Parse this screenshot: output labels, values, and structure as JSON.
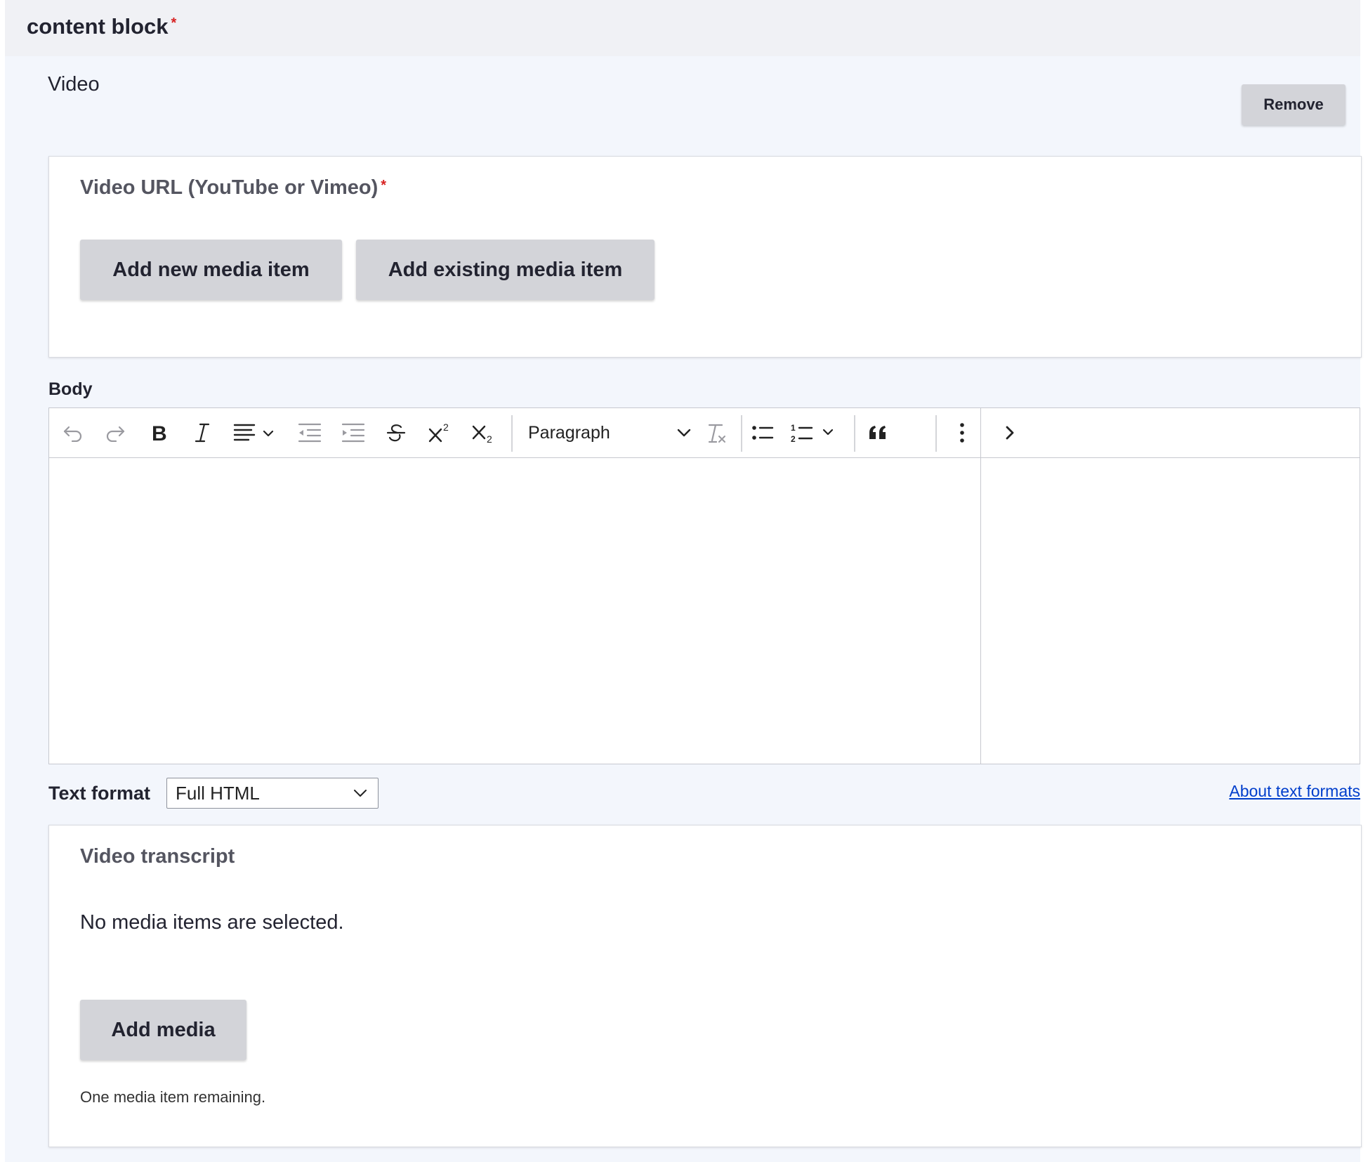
{
  "outer": {
    "title": "content block",
    "required_mark": "*"
  },
  "paragraph": {
    "type_label": "Video",
    "remove_label": "Remove"
  },
  "video_url": {
    "title": "Video URL (YouTube or Vimeo)",
    "required_mark": "*",
    "add_new_label": "Add new media item",
    "add_existing_label": "Add existing media item"
  },
  "body": {
    "label": "Body",
    "toolbar": {
      "buttons": [
        "undo-icon",
        "redo-icon",
        "bold-icon",
        "italic-icon",
        "align-icon",
        "outdent-icon",
        "indent-icon",
        "strikethrough-icon",
        "superscript-icon",
        "subscript-icon",
        "remove-format-icon",
        "bulleted-list-icon",
        "numbered-list-icon",
        "blockquote-icon",
        "more-icon",
        "chevron-right-icon"
      ],
      "heading_select_value": "Paragraph"
    }
  },
  "text_format": {
    "label": "Text format",
    "selected": "Full HTML",
    "about_link": "About text formats"
  },
  "transcript": {
    "title": "Video transcript",
    "empty_message": "No media items are selected.",
    "add_media_label": "Add media",
    "remaining_text": "One media item remaining."
  },
  "colors": {
    "background": "#f3f6fc",
    "header": "#f0f1f5",
    "button": "#d3d4d9",
    "required": "#d72222",
    "link": "#003ecc"
  }
}
